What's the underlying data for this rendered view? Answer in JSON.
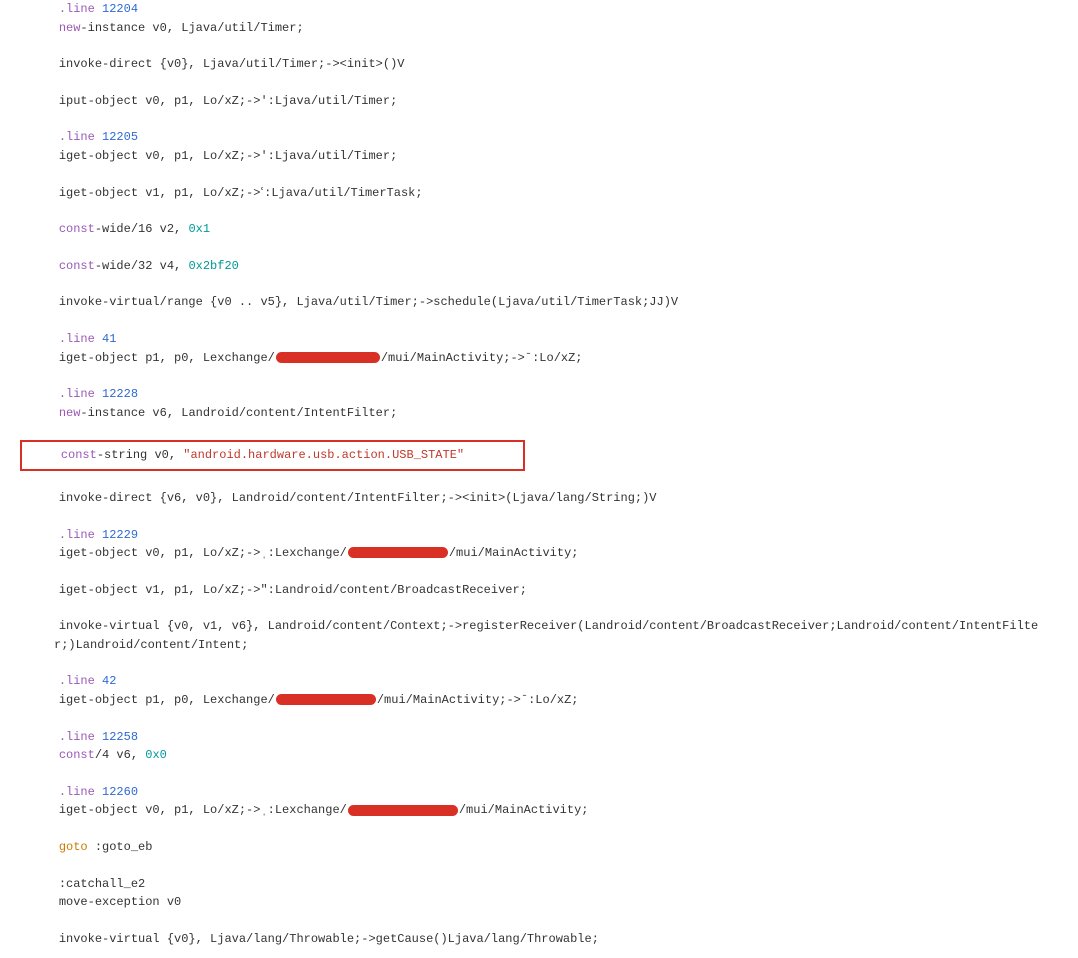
{
  "tokens": {
    "line_kw": ".line",
    "new_kw": "new",
    "const_kw": "const",
    "goto_kw": "goto"
  },
  "nums": {
    "n12204": "12204",
    "n12205": "12205",
    "n41": "41",
    "n12228": "12228",
    "n12229": "12229",
    "n42": "42",
    "n12258": "12258",
    "n12260": "12260",
    "hex0x1": "0x1",
    "hex0x2bf20": "0x2bf20",
    "hex0x0": "0x0"
  },
  "text": {
    "inst_timer": "-instance v0, Ljava/util/Timer;",
    "invoke_timer_init": "invoke-direct {v0}, Ljava/util/Timer;-><init>()V",
    "iput_timer": "iput-object v0, p1, Lo/xZ;->ʹ:Ljava/util/Timer;",
    "iget_timer": "iget-object v0, p1, Lo/xZ;->ʹ:Ljava/util/Timer;",
    "iget_timertask": "iget-object v1, p1, Lo/xZ;->ՙ:Ljava/util/TimerTask;",
    "const_wide16": "-wide/16 v2, ",
    "const_wide32": "-wide/32 v4, ",
    "invoke_schedule": "invoke-virtual/range {v0 .. v5}, Ljava/util/Timer;->schedule(Ljava/util/TimerTask;JJ)V",
    "iget_p1p0_a": "iget-object p1, p0, Lexchange/",
    "iget_p1p0_a_tail": "/mui/MainActivity;->ˉ:Lo/xZ;",
    "new_intentfilter": "-instance v6, Landroid/content/IntentFilter;",
    "const_string_pre": "-string v0, ",
    "usb_state": "\"android.hardware.usb.action.USB_STATE\"",
    "invoke_ifilter_init": "invoke-direct {v6, v0}, Landroid/content/IntentFilter;-><init>(Ljava/lang/String;)V",
    "iget_v0p1_a": "iget-object v0, p1, Lo/xZ;->ˌ:Lexchange/",
    "iget_v0p1_a_tail": "/mui/MainActivity;",
    "iget_v1p1_br": "iget-object v1, p1, Lo/xZ;->\":Landroid/content/BroadcastReceiver;",
    "invoke_register": "invoke-virtual {v0, v1, v6}, Landroid/content/Context;->registerReceiver(Landroid/content/BroadcastReceiver;Landroid/content/IntentFilter;)Landroid/content/Intent;",
    "const4": "/4 v6, ",
    "iget_v0p1_b": "iget-object v0, p1, Lo/xZ;->ˌ:Lexchange/",
    "iget_v0p1_b_tail": "/mui/MainActivity;",
    "goto_eb": " :goto_eb",
    "catchall": ":catchall_e2",
    "move_exc": "move-exception v0",
    "invoke_getcause": "invoke-virtual {v0}, Ljava/lang/Throwable;->getCause()Ljava/lang/Throwable;"
  },
  "redaction_widths": {
    "w1": 104,
    "w2": 100,
    "w3": 100,
    "w4": 110
  }
}
